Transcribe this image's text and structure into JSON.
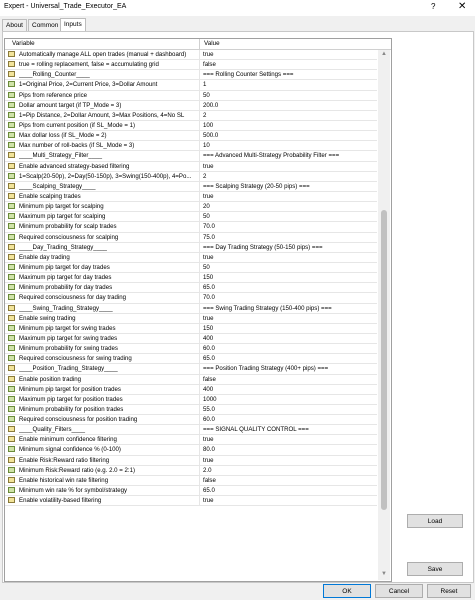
{
  "window": {
    "title": "Expert - Universal_Trade_Executor_EA",
    "help": "?",
    "close": "✕"
  },
  "tabs": [
    "About",
    "Common",
    "Inputs"
  ],
  "grid": {
    "col_variable": "Variable",
    "col_value": "Value"
  },
  "rows": [
    {
      "var": "Automatically manage ALL open trades (manual + dashboard)",
      "val": "true",
      "icon": "ab"
    },
    {
      "var": "true = rolling replacement, false = accumulating grid",
      "val": "false",
      "icon": "ab"
    },
    {
      "var": "____Rolling_Counter____",
      "val": "=== Rolling Counter Settings ===",
      "icon": "sep"
    },
    {
      "var": "1=Original Price, 2=Current Price, 3=Dollar Amount",
      "val": "1",
      "icon": "num"
    },
    {
      "var": "Pips from reference price",
      "val": "50",
      "icon": "num"
    },
    {
      "var": "Dollar amount target (if TP_Mode = 3)",
      "val": "200.0",
      "icon": "num"
    },
    {
      "var": "1=Pip Distance, 2=Dollar Amount, 3=Max Positions, 4=No SL",
      "val": "2",
      "icon": "num"
    },
    {
      "var": "Pips from current position (if SL_Mode = 1)",
      "val": "100",
      "icon": "num"
    },
    {
      "var": "Max dollar loss (if SL_Mode = 2)",
      "val": "500.0",
      "icon": "num"
    },
    {
      "var": "Max number of roll-backs (if SL_Mode = 3)",
      "val": "10",
      "icon": "num"
    },
    {
      "var": "____Multi_Strategy_Filter____",
      "val": "=== Advanced Multi-Strategy Probability Filter ===",
      "icon": "sep"
    },
    {
      "var": "Enable advanced strategy-based filtering",
      "val": "true",
      "icon": "ab"
    },
    {
      "var": "1=Scalp(20-50p), 2=Day(50-150p), 3=Swing(150-400p), 4=Po...",
      "val": "2",
      "icon": "num"
    },
    {
      "var": "____Scalping_Strategy____",
      "val": "=== Scalping Strategy (20-50 pips) ===",
      "icon": "sep"
    },
    {
      "var": "Enable scalping trades",
      "val": "true",
      "icon": "ab"
    },
    {
      "var": "Minimum pip target for scalping",
      "val": "20",
      "icon": "num"
    },
    {
      "var": "Maximum pip target for scalping",
      "val": "50",
      "icon": "num"
    },
    {
      "var": "Minimum probability for scalp trades",
      "val": "70.0",
      "icon": "num"
    },
    {
      "var": "Required consciousness for scalping",
      "val": "75.0",
      "icon": "num"
    },
    {
      "var": "____Day_Trading_Strategy____",
      "val": "=== Day Trading Strategy (50-150 pips) ===",
      "icon": "sep"
    },
    {
      "var": "Enable day trading",
      "val": "true",
      "icon": "ab"
    },
    {
      "var": "Minimum pip target for day trades",
      "val": "50",
      "icon": "num"
    },
    {
      "var": "Maximum pip target for day trades",
      "val": "150",
      "icon": "num"
    },
    {
      "var": "Minimum probability for day trades",
      "val": "65.0",
      "icon": "num"
    },
    {
      "var": "Required consciousness for day trading",
      "val": "70.0",
      "icon": "num"
    },
    {
      "var": "____Swing_Trading_Strategy____",
      "val": "=== Swing Trading Strategy (150-400 pips) ===",
      "icon": "sep"
    },
    {
      "var": "Enable swing trading",
      "val": "true",
      "icon": "ab"
    },
    {
      "var": "Minimum pip target for swing trades",
      "val": "150",
      "icon": "num"
    },
    {
      "var": "Maximum pip target for swing trades",
      "val": "400",
      "icon": "num"
    },
    {
      "var": "Minimum probability for swing trades",
      "val": "60.0",
      "icon": "num"
    },
    {
      "var": "Required consciousness for swing trading",
      "val": "65.0",
      "icon": "num"
    },
    {
      "var": "____Position_Trading_Strategy____",
      "val": "=== Position Trading Strategy (400+ pips) ===",
      "icon": "sep"
    },
    {
      "var": "Enable position trading",
      "val": "false",
      "icon": "ab"
    },
    {
      "var": "Minimum pip target for position trades",
      "val": "400",
      "icon": "num"
    },
    {
      "var": "Maximum pip target for position trades",
      "val": "1000",
      "icon": "num"
    },
    {
      "var": "Minimum probability for position trades",
      "val": "55.0",
      "icon": "num"
    },
    {
      "var": "Required consciousness for position trading",
      "val": "60.0",
      "icon": "num"
    },
    {
      "var": "____Quality_Filters____",
      "val": "=== SIGNAL QUALITY CONTROL ===",
      "icon": "sep"
    },
    {
      "var": "Enable minimum confidence filtering",
      "val": "true",
      "icon": "ab"
    },
    {
      "var": "Minimum signal confidence % (0-100)",
      "val": "80.0",
      "icon": "num"
    },
    {
      "var": "Enable Risk:Reward ratio filtering",
      "val": "true",
      "icon": "ab"
    },
    {
      "var": "Minimum Risk:Reward ratio (e.g. 2.0 = 2:1)",
      "val": "2.0",
      "icon": "num"
    },
    {
      "var": "Enable historical win rate filtering",
      "val": "false",
      "icon": "ab"
    },
    {
      "var": "Minimum win rate % for symbol/strategy",
      "val": "65.0",
      "icon": "num"
    },
    {
      "var": "Enable volatility-based filtering",
      "val": "true",
      "icon": "ab"
    }
  ],
  "buttons": {
    "load": "Load",
    "save": "Save",
    "ok": "OK",
    "cancel": "Cancel",
    "reset": "Reset"
  }
}
